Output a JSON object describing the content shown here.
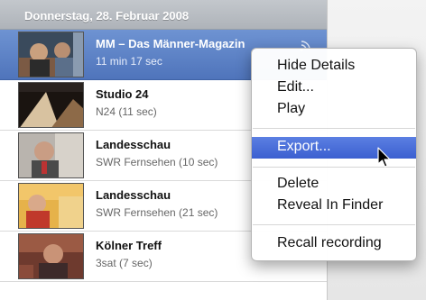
{
  "list": {
    "date_header": "Donnerstag, 28. Februar 2008",
    "items": [
      {
        "title": "MM – Das Männer-Magazin",
        "subtitle": "11 min 17 sec"
      },
      {
        "title": "Studio 24",
        "subtitle": "N24 (11 sec)"
      },
      {
        "title": "Landesschau",
        "subtitle": "SWR Fernsehen (10 sec)"
      },
      {
        "title": "Landesschau",
        "subtitle": "SWR Fernsehen (21 sec)"
      },
      {
        "title": "Kölner Treff",
        "subtitle": "3sat (7 sec)"
      }
    ]
  },
  "context_menu": {
    "hide_details": "Hide Details",
    "edit": "Edit...",
    "play": "Play",
    "export": "Export...",
    "delete": "Delete",
    "reveal_in_finder": "Reveal In Finder",
    "recall_recording": "Recall recording"
  },
  "colors": {
    "selection_blue": "#5577c0",
    "menu_highlight": "#3b5fd0"
  },
  "icons": [
    "broadcast-icon",
    "mouse-pointer-icon"
  ]
}
